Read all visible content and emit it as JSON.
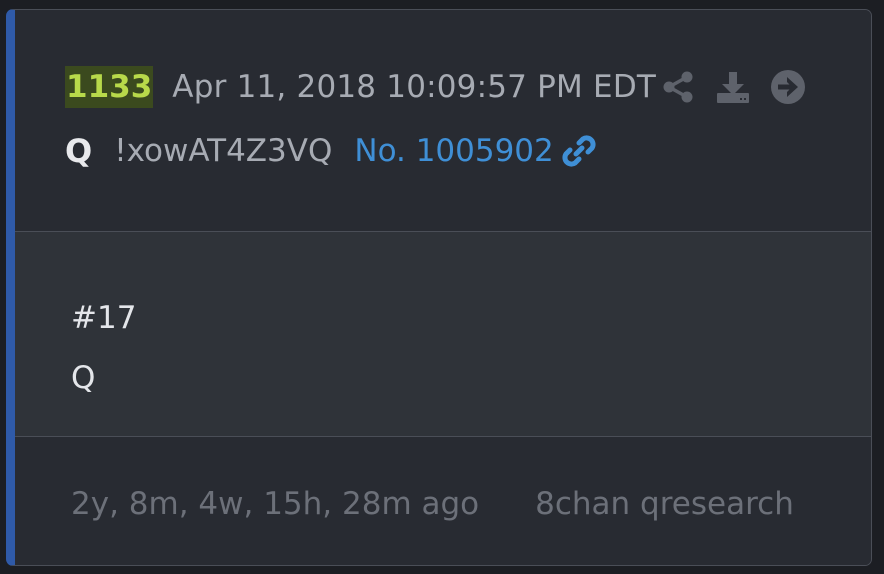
{
  "post": {
    "count": "1133",
    "timestamp": "Apr 11, 2018 10:09:57 PM EDT",
    "author": "Q",
    "tripcode": "!xowAT4Z3VQ",
    "number": "No. 1005902",
    "body_lines": [
      "#17",
      "Q"
    ],
    "age": "2y, 8m, 4w, 15h, 28m ago",
    "source": "8chan qresearch"
  },
  "icons": {
    "share": "share-icon",
    "download": "download-icon",
    "go": "arrow-right-circle-icon",
    "link": "link-icon"
  },
  "colors": {
    "accent_border": "#2f5aa8",
    "count_highlight_bg": "#3b4a1e",
    "count_highlight_fg": "#b8d94a",
    "link": "#3f8fd6"
  }
}
